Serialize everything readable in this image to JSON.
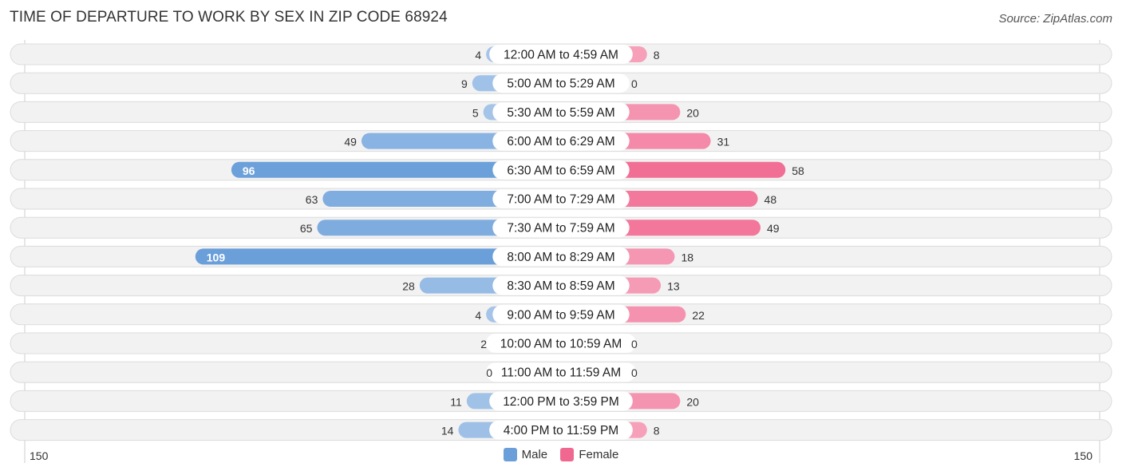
{
  "header": {
    "title": "TIME OF DEPARTURE TO WORK BY SEX IN ZIP CODE 68924",
    "source": "Source: ZipAtlas.com"
  },
  "colors": {
    "male": "#6a9fda",
    "male_light": "#a7c6e9",
    "female": "#f06890",
    "female_light": "#f7a8c0",
    "row_bg": "#f2f2f2"
  },
  "chart_data": {
    "type": "bar",
    "orientation": "horizontal-diverging",
    "title": "TIME OF DEPARTURE TO WORK BY SEX IN ZIP CODE 68924",
    "categories": [
      "12:00 AM to 4:59 AM",
      "5:00 AM to 5:29 AM",
      "5:30 AM to 5:59 AM",
      "6:00 AM to 6:29 AM",
      "6:30 AM to 6:59 AM",
      "7:00 AM to 7:29 AM",
      "7:30 AM to 7:59 AM",
      "8:00 AM to 8:29 AM",
      "8:30 AM to 8:59 AM",
      "9:00 AM to 9:59 AM",
      "10:00 AM to 10:59 AM",
      "11:00 AM to 11:59 AM",
      "12:00 PM to 3:59 PM",
      "4:00 PM to 11:59 PM"
    ],
    "series": [
      {
        "name": "Male",
        "values": [
          4,
          9,
          5,
          49,
          96,
          63,
          65,
          109,
          28,
          4,
          2,
          0,
          11,
          14
        ]
      },
      {
        "name": "Female",
        "values": [
          8,
          0,
          20,
          31,
          58,
          48,
          49,
          18,
          13,
          22,
          0,
          0,
          20,
          8
        ]
      }
    ],
    "axis": {
      "left_label": "150",
      "right_label": "150",
      "range": [
        0,
        150
      ]
    },
    "legend": {
      "position": "bottom-center",
      "entries": [
        "Male",
        "Female"
      ]
    },
    "grid": false
  }
}
